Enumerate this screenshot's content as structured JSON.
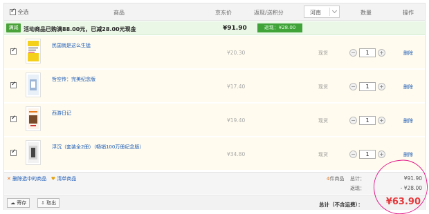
{
  "header": {
    "select_all": "全选",
    "product": "商品",
    "price": "京东价",
    "rebate": "返现/送积分",
    "region": "河南",
    "quantity": "数量",
    "action": "操作"
  },
  "promo": {
    "tag": "满减",
    "text": "活动商品已购满88.00元，已减28.00元现金",
    "subtotal": "¥91.90",
    "rebate": "返现：¥28.00"
  },
  "items": [
    {
      "title": "民国就是这么生猛",
      "price": "¥20.30",
      "stock": "现货",
      "qty": "1",
      "delete": "删除",
      "checked": true
    },
    {
      "title": "哲空传：完美纪念版",
      "price": "¥17.40",
      "stock": "现货",
      "qty": "1",
      "delete": "删除",
      "checked": true
    },
    {
      "title": "西游日记",
      "price": "¥19.40",
      "stock": "现货",
      "qty": "1",
      "delete": "删除",
      "checked": true
    },
    {
      "title": "浮沉（套装全2册）（畅销100万册纪念版）",
      "price": "¥34.80",
      "stock": "现货",
      "qty": "1",
      "delete": "删除",
      "checked": true
    }
  ],
  "footer": {
    "delete_selected": "删除选中的商品",
    "favorites": "清单商品",
    "count": "4",
    "count_suffix": "件商品",
    "total_label": "总计：",
    "total_value": "¥91.90",
    "rebate_label": "返现：",
    "rebate_value": "- ¥28.00",
    "save_btn": "寄存",
    "retrieve_btn": "取出",
    "grand_label": "总计（不含运费）：",
    "grand_value": "¥63.90"
  },
  "colors": {
    "accent_red": "#e4393c",
    "link_blue": "#1a5ab6",
    "promo_green": "#3fa33a",
    "annotation_pink": "#e21a8a"
  }
}
